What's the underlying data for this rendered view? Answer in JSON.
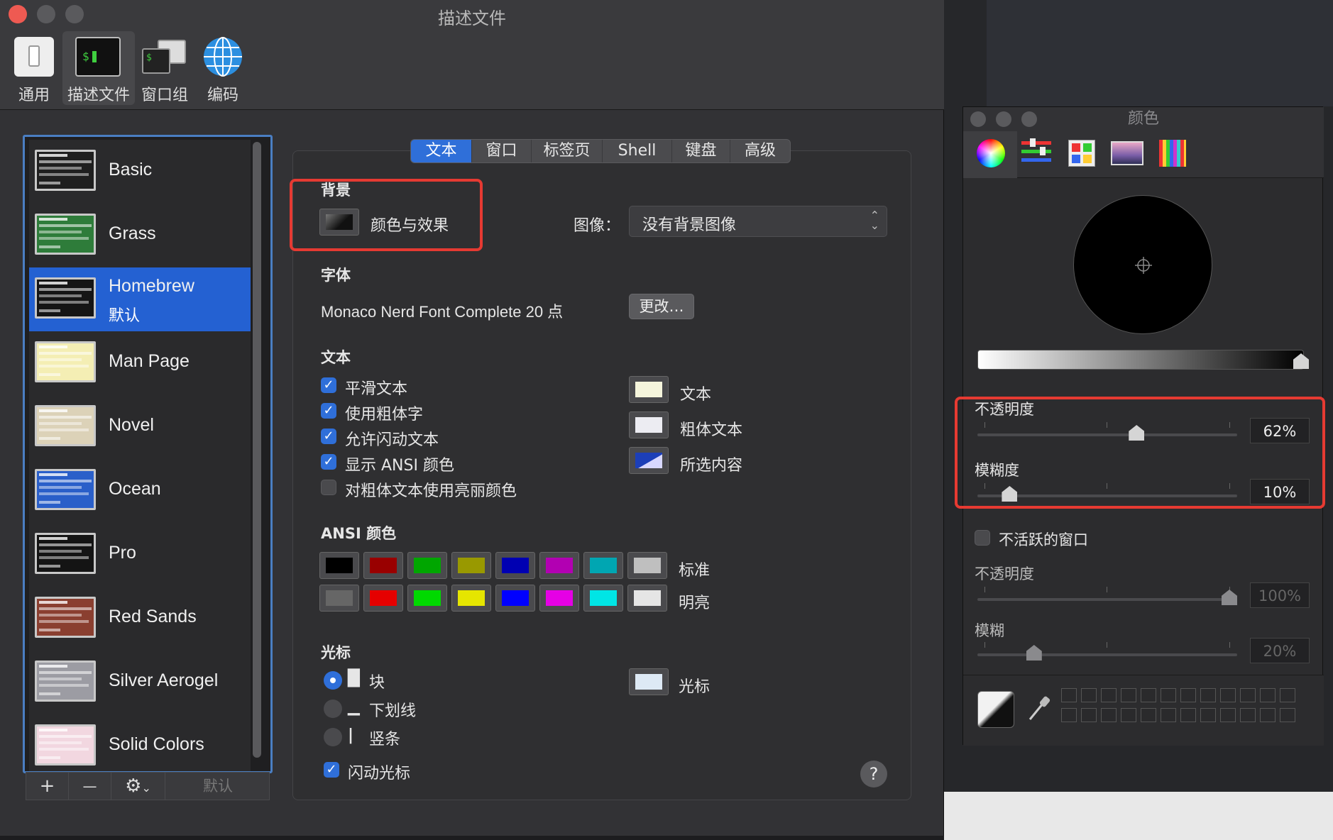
{
  "window": {
    "title": "描述文件"
  },
  "toolbar": {
    "items": [
      {
        "label": "通用",
        "icon": "switch-icon"
      },
      {
        "label": "描述文件",
        "icon": "terminal-icon"
      },
      {
        "label": "窗口组",
        "icon": "window-group-icon"
      },
      {
        "label": "编码",
        "icon": "globe-icon"
      }
    ],
    "selected": "描述文件"
  },
  "profiles": {
    "items": [
      {
        "name": "Basic",
        "theme_color": "#1f1f1f"
      },
      {
        "name": "Grass",
        "theme_color": "#2e7c3a"
      },
      {
        "name": "Homebrew",
        "default_label": "默认",
        "theme_color": "#151515",
        "selected": true
      },
      {
        "name": "Man Page",
        "theme_color": "#f4eeb4"
      },
      {
        "name": "Novel",
        "theme_color": "#dcd2b8"
      },
      {
        "name": "Ocean",
        "theme_color": "#2a5fc9"
      },
      {
        "name": "Pro",
        "theme_color": "#141414"
      },
      {
        "name": "Red Sands",
        "theme_color": "#8a3f30"
      },
      {
        "name": "Silver Aerogel",
        "theme_color": "#9c9ca3"
      },
      {
        "name": "Solid Colors",
        "theme_color": "#f2d7e0"
      }
    ],
    "buttons": {
      "add": "+",
      "remove": "—",
      "gear": "⚙",
      "default": "默认"
    }
  },
  "tabs": [
    "文本",
    "窗口",
    "标签页",
    "Shell",
    "键盘",
    "高级"
  ],
  "selected_tab": "文本",
  "background": {
    "section": "背景",
    "effects_label": "颜色与效果",
    "image_label": "图像：",
    "image_value": "没有背景图像"
  },
  "font": {
    "section": "字体",
    "value": "Monaco Nerd Font Complete 20 点",
    "change_button": "更改…"
  },
  "text": {
    "section": "文本",
    "options": [
      {
        "label": "平滑文本",
        "checked": true
      },
      {
        "label": "使用粗体字",
        "checked": true
      },
      {
        "label": "允许闪动文本",
        "checked": true
      },
      {
        "label": "显示 ANSI 颜色",
        "checked": true
      },
      {
        "label": "对粗体文本使用亮丽颜色",
        "checked": false
      }
    ],
    "colors": [
      {
        "label": "文本",
        "color": "#f5f5dc"
      },
      {
        "label": "粗体文本",
        "color": "#ececf2"
      },
      {
        "label": "所选内容",
        "color": "#1c3fb8"
      }
    ]
  },
  "ansi": {
    "section": "ANSI 颜色",
    "standard_label": "标准",
    "bright_label": "明亮",
    "standard": [
      "#000000",
      "#990000",
      "#00a600",
      "#999900",
      "#0000b2",
      "#b200b2",
      "#00a6b2",
      "#bfbfbf"
    ],
    "bright": [
      "#666666",
      "#e50000",
      "#00d900",
      "#e5e500",
      "#0000ff",
      "#e500e5",
      "#00e5e5",
      "#e5e5e5"
    ]
  },
  "cursor": {
    "section": "光标",
    "options": [
      {
        "label": "块",
        "glyph": "█",
        "selected": true
      },
      {
        "label": "下划线",
        "glyph": "▁",
        "selected": false
      },
      {
        "label": "竖条",
        "glyph": "|",
        "selected": false
      }
    ],
    "blink_label": "闪动光标",
    "blink_checked": true,
    "color_label": "光标",
    "color": "#dde9f5"
  },
  "help_label": "?",
  "color_panel": {
    "title": "颜色",
    "tools": [
      "color-wheel-icon",
      "color-sliders-icon",
      "color-palettes-icon",
      "image-palettes-icon",
      "pencils-icon"
    ],
    "opacity_label": "不透明度",
    "opacity_value": "62%",
    "opacity_fraction": 0.62,
    "blur_label": "模糊度",
    "blur_value": "10%",
    "blur_fraction": 0.1,
    "inactive_label": "不活跃的窗口",
    "inactive_checked": false,
    "inactive_opacity_label": "不透明度",
    "inactive_opacity_value": "100%",
    "inactive_opacity_fraction": 1.0,
    "inactive_blur_label": "模糊",
    "inactive_blur_value": "20%",
    "inactive_blur_fraction": 0.2
  }
}
